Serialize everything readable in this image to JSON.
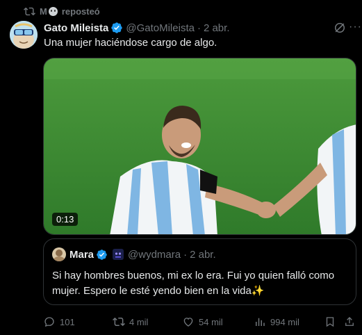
{
  "repost": {
    "reposter": "M",
    "label": "reposteó"
  },
  "tweet": {
    "author_name": "Gato Mileista",
    "handle": "@GatoMileista",
    "separator": "·",
    "date": "2 abr.",
    "text": "Una mujer haciéndose cargo de algo."
  },
  "media": {
    "duration": "0:13"
  },
  "quote": {
    "author_name": "Mara",
    "handle": "@wydmara",
    "separator": "·",
    "date": "2 abr.",
    "text": "Si hay hombres buenos, mi ex lo era. Fui yo quien falló como mujer. Espero le esté yendo bien en la vida✨"
  },
  "actions": {
    "replies": "101",
    "reposts": "4 mil",
    "likes": "54 mil",
    "views": "994 mil"
  },
  "colors": {
    "background": "#000000",
    "text": "#e7e9ea",
    "muted": "#71767b",
    "verified": "#1d9bf0",
    "border": "#2f3336"
  },
  "icons": [
    "repost-icon",
    "verified-icon",
    "grok-icon",
    "more-icon",
    "reply-icon",
    "like-icon",
    "views-icon",
    "bookmark-icon",
    "share-icon"
  ]
}
